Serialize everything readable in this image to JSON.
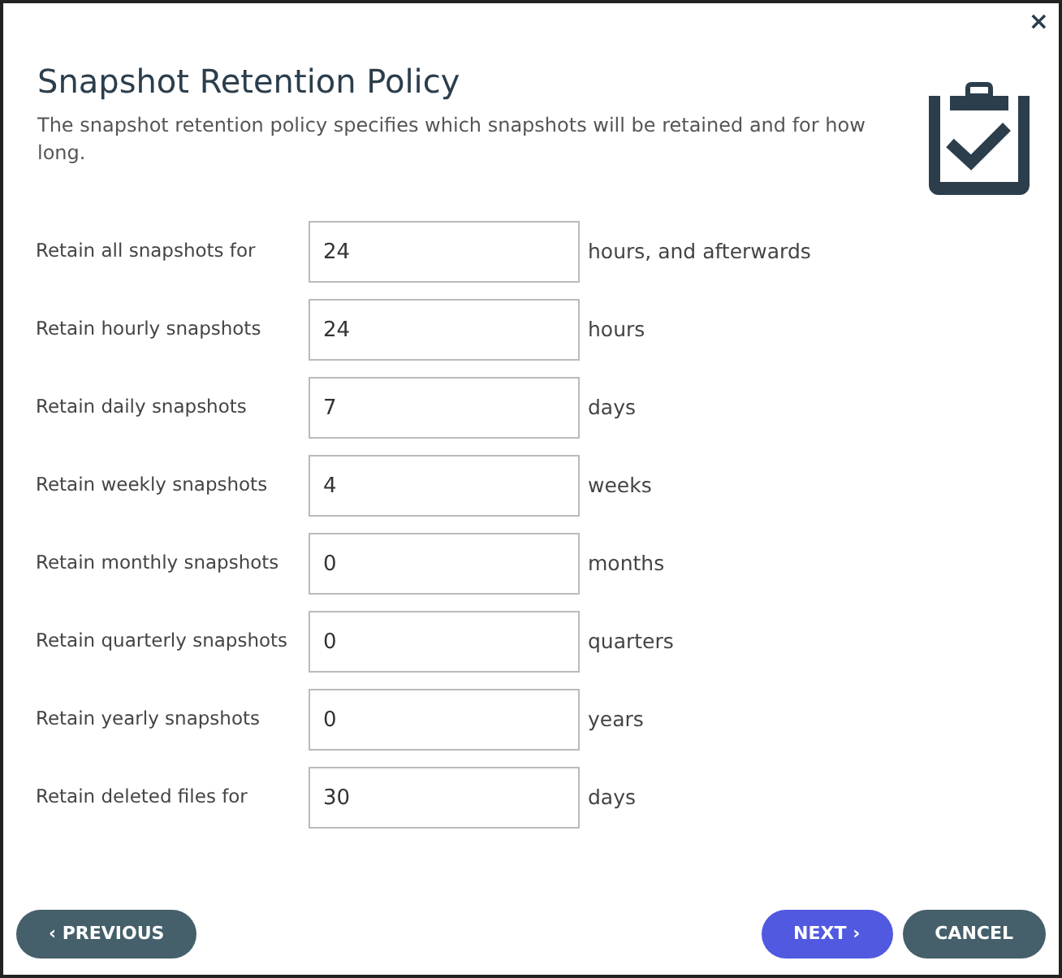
{
  "close_button": "×",
  "title": "Snapshot Retention Policy",
  "description": "The snapshot retention policy specifies which snapshots will be retained and for how long.",
  "fields": [
    {
      "label": "Retain all snapshots for",
      "value": "24",
      "unit": "hours, and afterwards"
    },
    {
      "label": "Retain hourly snapshots",
      "value": "24",
      "unit": "hours"
    },
    {
      "label": "Retain daily snapshots",
      "value": "7",
      "unit": "days"
    },
    {
      "label": "Retain weekly snapshots",
      "value": "4",
      "unit": "weeks"
    },
    {
      "label": "Retain monthly snapshots",
      "value": "0",
      "unit": "months"
    },
    {
      "label": "Retain quarterly snapshots",
      "value": "0",
      "unit": "quarters"
    },
    {
      "label": "Retain yearly snapshots",
      "value": "0",
      "unit": "years"
    },
    {
      "label": "Retain deleted files for",
      "value": "30",
      "unit": "days"
    }
  ],
  "left_buttons": [
    {
      "label": "‹ PREVIOUS",
      "kind": "secondary"
    }
  ],
  "right_buttons": [
    {
      "label": "NEXT ›",
      "kind": "primary"
    },
    {
      "label": "CANCEL",
      "kind": "secondary"
    }
  ]
}
